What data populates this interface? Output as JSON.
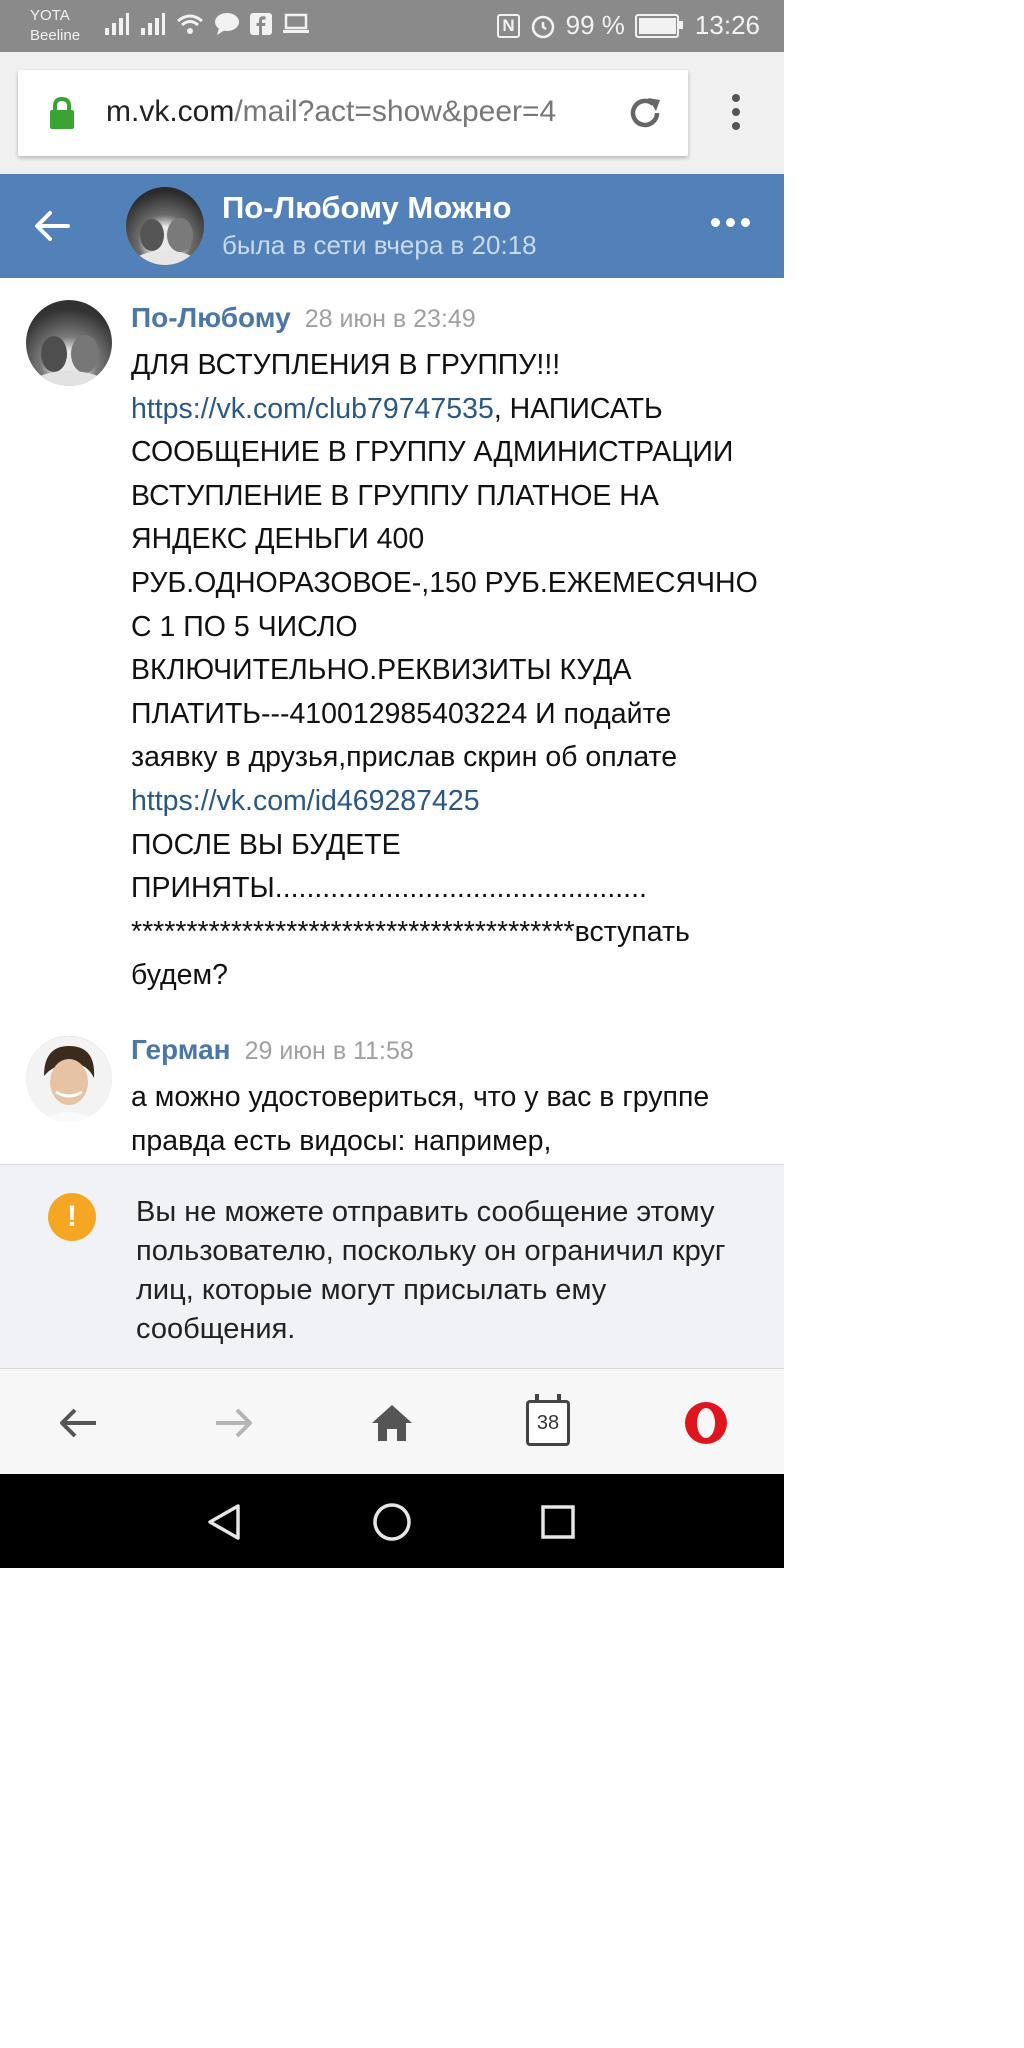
{
  "status_bar": {
    "carrier_line1": "YOTA",
    "carrier_line2": "Beeline",
    "battery_text": "99 %",
    "time": "13:26",
    "nfc_label": "N"
  },
  "browser": {
    "url_host": "m.vk.com",
    "url_path": "/mail?act=show&peer=4",
    "tab_count": "38"
  },
  "header": {
    "name": "По-Любому Можно",
    "status": "была в сети вчера в 20:18"
  },
  "messages": [
    {
      "author": "По-Любому",
      "time": "28 июн в 23:49",
      "text_part1": "ДЛЯ ВСТУПЛЕНИЯ В ГРУППУ!!!\n",
      "link1": "https://vk.com/club79747535",
      "text_part2": ", НАПИСАТЬ СООБЩЕНИЕ В ГРУППУ АДМИНИСТРАЦИИ ВСТУПЛЕНИЕ В ГРУППУ ПЛАТНОЕ НА ЯНДЕКС ДЕНЬГИ 400 РУБ.ОДНОРАЗОВОЕ-,150 РУБ.ЕЖЕМЕСЯЧНО С 1 ПО 5 ЧИСЛО ВКЛЮЧИТЕЛЬНО.РЕКВИЗИТЫ КУДА ПЛАТИТЬ---410012985403224 И подайте заявку в друзья,прислав скрин об оплате ",
      "link2": "https://vk.com/id469287425",
      "text_part3": "\nПОСЛЕ ВЫ БУДЕТЕ ПРИНЯТЫ...............................................\n****************************************вступать будем?"
    },
    {
      "author": "Герман",
      "time": "29 июн в 11:58",
      "text": "а можно удостовериться, что у вас в группе правда есть видосы: например,"
    }
  ],
  "notice": {
    "icon": "!",
    "text": "Вы не можете отправить сообщение этому пользователю, поскольку он ограничил круг лиц, которые могут присылать ему сообщения."
  },
  "colors": {
    "vk_blue": "#5181b8",
    "link": "#2a5885",
    "author": "#4a76a8",
    "warning": "#f5a623",
    "opera_red": "#e0141e"
  }
}
